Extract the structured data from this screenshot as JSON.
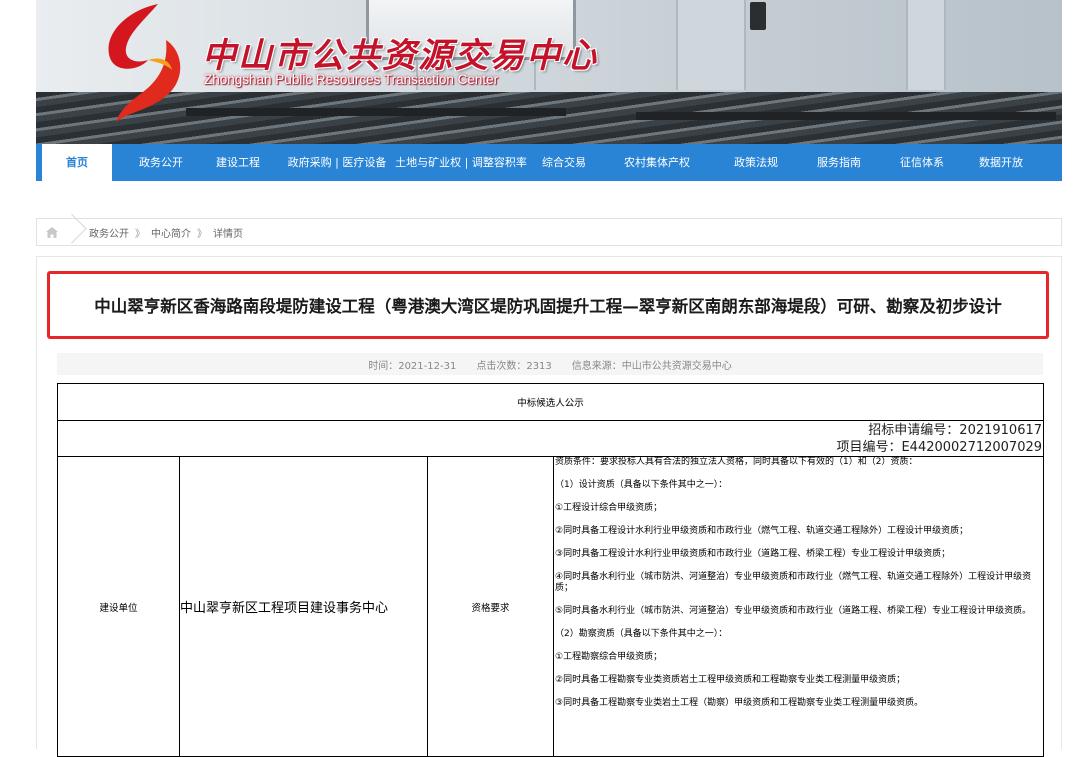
{
  "header": {
    "title_cn": "中山市公共资源交易中心",
    "title_en": "Zhongshan Public Resources Transaction Center"
  },
  "nav": {
    "items": [
      {
        "label": "首页",
        "active": true
      },
      {
        "label": "政务公开"
      },
      {
        "label": "建设工程"
      },
      {
        "label": "政府采购 | 医疗设备"
      },
      {
        "label": "土地与矿业权 | 调整容积率"
      },
      {
        "label": "综合交易"
      },
      {
        "label": "农村集体产权"
      },
      {
        "label": "政策法规"
      },
      {
        "label": "服务指南"
      },
      {
        "label": "征信体系"
      },
      {
        "label": "数据开放"
      }
    ]
  },
  "breadcrumb": {
    "items": [
      "政务公开",
      "中心简介",
      "详情页"
    ],
    "separator": "》"
  },
  "article": {
    "title": "中山翠亨新区香海路南段堤防建设工程（粤港澳大湾区堤防巩固提升工程—翠亨新区南朗东部海堤段）可研、勘察及初步设计",
    "meta": {
      "time": "时间：2021-12-31",
      "views": "点击次数：2313",
      "source": "信息来源：中山市公共资源交易中心"
    }
  },
  "table": {
    "caption": "中标候选人公示",
    "tender_no": "招标申请编号：2021910617",
    "project_no": "项目编号：E4420002712007029",
    "owner_label": "建设单位",
    "owner_value": "中山翠亨新区工程项目建设事务中心",
    "req_label": "资格要求",
    "requirements": [
      "资质条件：要求投标人具有合法的独立法人资格，同时具备以下有效的（1）和（2）资质：",
      "（1）设计资质（具备以下条件其中之一）：",
      "①工程设计综合甲级资质；",
      "②同时具备工程设计水利行业甲级资质和市政行业（燃气工程、轨道交通工程除外）工程设计甲级资质；",
      "③同时具备工程设计水利行业甲级资质和市政行业（道路工程、桥梁工程）专业工程设计甲级资质；",
      "④同时具备水利行业（城市防洪、河道整治）专业甲级资质和市政行业（燃气工程、轨道交通工程除外）工程设计甲级资质；",
      "⑤同时具备水利行业（城市防洪、河道整治）专业甲级资质和市政行业（道路工程、桥梁工程）专业工程设计甲级资质。",
      "（2）勘察资质（具备以下条件其中之一）：",
      "①工程勘察综合甲级资质；",
      "②同时具备工程勘察专业类资质岩土工程甲级资质和工程勘察专业类工程测量甲级资质；",
      "③同时具备工程勘察专业类岩土工程（勘察）甲级资质和工程勘察专业类工程测量甲级资质。"
    ]
  },
  "colors": {
    "nav_bg": "#2a84d6",
    "title_brand": "#c4122b",
    "highlight_border": "#e8262a"
  },
  "icons": {
    "home": "home-icon",
    "logo": "logo-icon"
  }
}
